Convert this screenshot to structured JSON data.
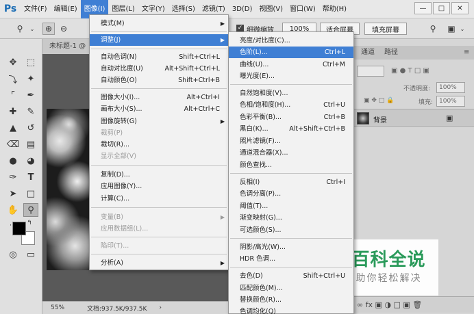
{
  "app": {
    "logo": "Ps"
  },
  "menubar": {
    "items": [
      {
        "label": "文件(F)"
      },
      {
        "label": "编辑(E)"
      },
      {
        "label": "图像(I)"
      },
      {
        "label": "图层(L)"
      },
      {
        "label": "文字(Y)"
      },
      {
        "label": "选择(S)"
      },
      {
        "label": "滤镜(T)"
      },
      {
        "label": "3D(D)"
      },
      {
        "label": "视图(V)"
      },
      {
        "label": "窗口(W)"
      },
      {
        "label": "帮助(H)"
      }
    ],
    "active_index": 2,
    "window_controls": {
      "minimize": "—",
      "restore": "□",
      "close": "✕"
    }
  },
  "options_bar": {
    "checkbox_label": "细微缩放",
    "zoom_value": "100%",
    "fit_screen": "适合屏幕",
    "fill_screen": "填充屏幕"
  },
  "document": {
    "tab_title": "未标题-1 @",
    "status_zoom": "55%",
    "status_doc": "文档:937.5K/937.5K"
  },
  "right_panel": {
    "tabs": [
      "通道",
      "路径"
    ],
    "opacity_label": "不透明度:",
    "opacity_value": "100%",
    "fill_label": "填充:",
    "fill_value": "100%",
    "layer_name": "背景"
  },
  "image_menu": {
    "items": [
      {
        "label": "模式(M)",
        "shortcut": "",
        "submenu": true
      },
      {
        "label": "调整(J)",
        "shortcut": "",
        "submenu": true
      },
      {
        "label": "自动色调(N)",
        "shortcut": "Shift+Ctrl+L"
      },
      {
        "label": "自动对比度(U)",
        "shortcut": "Alt+Shift+Ctrl+L"
      },
      {
        "label": "自动颜色(O)",
        "shortcut": "Shift+Ctrl+B"
      },
      {
        "label": "图像大小(I)...",
        "shortcut": "Alt+Ctrl+I"
      },
      {
        "label": "画布大小(S)...",
        "shortcut": "Alt+Ctrl+C"
      },
      {
        "label": "图像旋转(G)",
        "shortcut": "",
        "submenu": true
      },
      {
        "label": "裁剪(P)",
        "shortcut": "",
        "disabled": true
      },
      {
        "label": "裁切(R)...",
        "shortcut": ""
      },
      {
        "label": "显示全部(V)",
        "shortcut": "",
        "disabled": true
      },
      {
        "label": "复制(D)...",
        "shortcut": ""
      },
      {
        "label": "应用图像(Y)...",
        "shortcut": ""
      },
      {
        "label": "计算(C)...",
        "shortcut": ""
      },
      {
        "label": "变量(B)",
        "shortcut": "",
        "submenu": true,
        "disabled": true
      },
      {
        "label": "应用数据组(L)...",
        "shortcut": "",
        "disabled": true
      },
      {
        "label": "陷印(T)...",
        "shortcut": "",
        "disabled": true
      },
      {
        "label": "分析(A)",
        "shortcut": "",
        "submenu": true
      }
    ],
    "highlighted_index": 1
  },
  "adjust_menu": {
    "items": [
      {
        "label": "亮度/对比度(C)...",
        "shortcut": ""
      },
      {
        "label": "色阶(L)...",
        "shortcut": "Ctrl+L"
      },
      {
        "label": "曲线(U)...",
        "shortcut": "Ctrl+M"
      },
      {
        "label": "曝光度(E)...",
        "shortcut": ""
      },
      {
        "label": "自然饱和度(V)...",
        "shortcut": ""
      },
      {
        "label": "色相/饱和度(H)...",
        "shortcut": "Ctrl+U"
      },
      {
        "label": "色彩平衡(B)...",
        "shortcut": "Ctrl+B"
      },
      {
        "label": "黑白(K)...",
        "shortcut": "Alt+Shift+Ctrl+B"
      },
      {
        "label": "照片滤镜(F)...",
        "shortcut": ""
      },
      {
        "label": "通道混合器(X)...",
        "shortcut": ""
      },
      {
        "label": "颜色查找...",
        "shortcut": ""
      },
      {
        "label": "反相(I)",
        "shortcut": "Ctrl+I"
      },
      {
        "label": "色调分离(P)...",
        "shortcut": ""
      },
      {
        "label": "阈值(T)...",
        "shortcut": ""
      },
      {
        "label": "渐变映射(G)...",
        "shortcut": ""
      },
      {
        "label": "可选颜色(S)...",
        "shortcut": ""
      },
      {
        "label": "阴影/高光(W)...",
        "shortcut": ""
      },
      {
        "label": "HDR 色调...",
        "shortcut": ""
      },
      {
        "label": "去色(D)",
        "shortcut": "Shift+Ctrl+U"
      },
      {
        "label": "匹配颜色(M)...",
        "shortcut": ""
      },
      {
        "label": "替换颜色(R)...",
        "shortcut": ""
      },
      {
        "label": "色调均化(Q)",
        "shortcut": ""
      }
    ],
    "highlighted_index": 1
  },
  "watermark": {
    "title": "百科全说",
    "subtitle": "助你轻松解决"
  },
  "colors": {
    "menu_highlight": "#3f7fd4",
    "watermark_green": "#2a9a5a"
  }
}
